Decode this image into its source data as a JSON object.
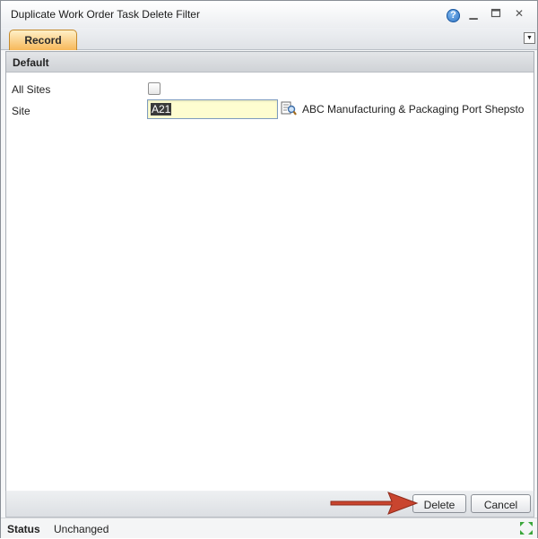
{
  "window": {
    "title": "Duplicate Work Order Task Delete Filter",
    "help_glyph": "?",
    "minimize_glyph": "▁",
    "restore_glyph": "▫",
    "close_glyph": "✕"
  },
  "tabs": [
    {
      "label": "Record",
      "active": true
    }
  ],
  "tab_menu_glyph": "▼",
  "section": {
    "title": "Default"
  },
  "fields": {
    "all_sites": {
      "label": "All Sites",
      "checked": false
    },
    "site": {
      "label": "Site",
      "value": "A21",
      "description": "ABC Manufacturing & Packaging Port Shepsto"
    }
  },
  "buttons": {
    "delete": "Delete",
    "cancel": "Cancel"
  },
  "status": {
    "label": "Status",
    "value": "Unchanged"
  },
  "colors": {
    "tab_active": "#f7b85a",
    "input_bg": "#fefdd0",
    "arrow": "#c9452f"
  },
  "icons": {
    "help": "help-icon",
    "lookup": "lookup-icon",
    "expand": "expand-icon",
    "arrow": "arrow-icon"
  }
}
